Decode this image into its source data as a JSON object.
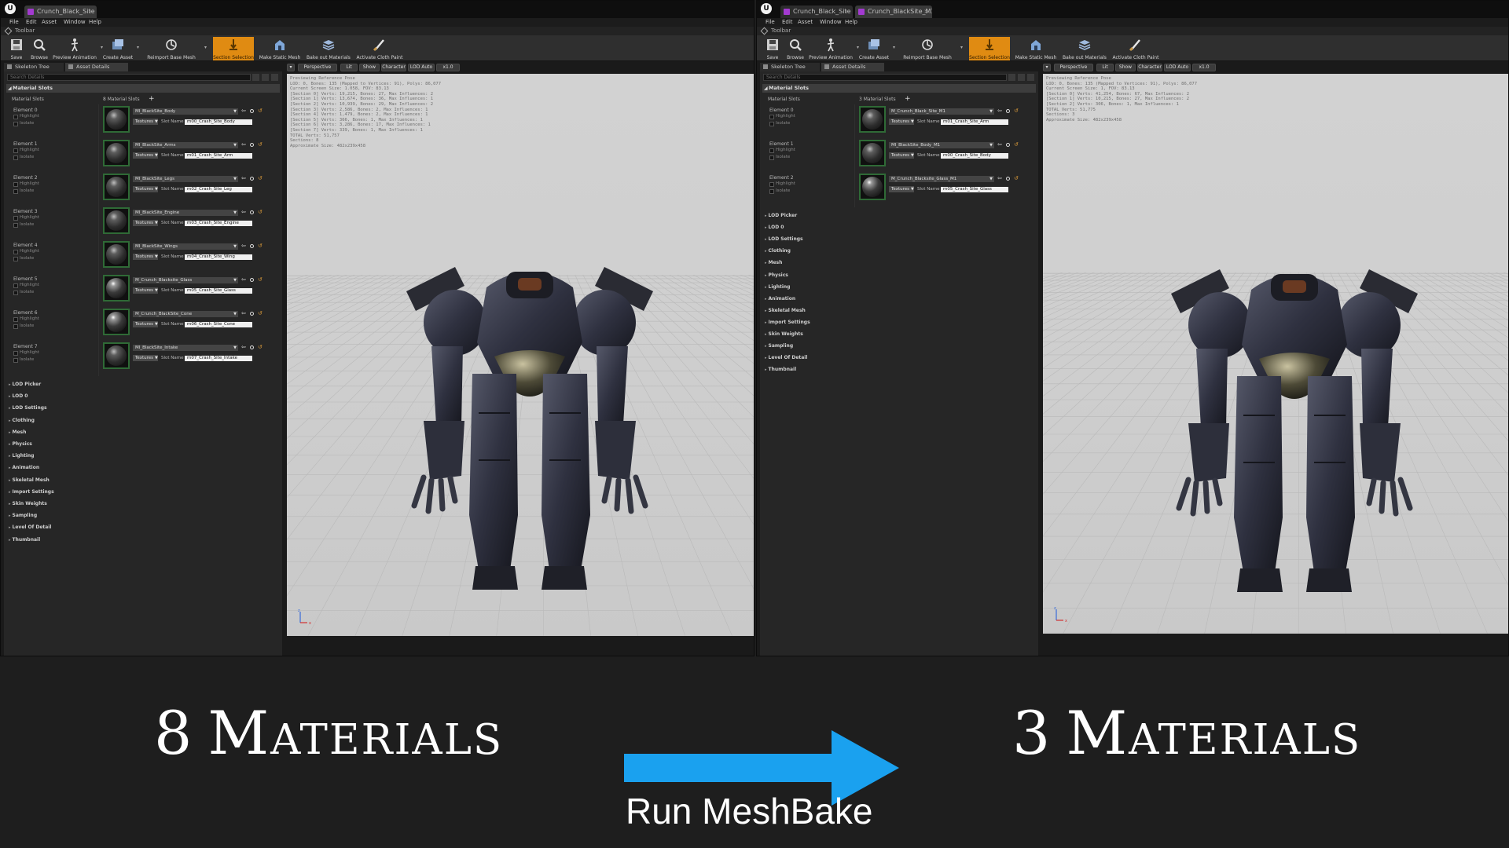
{
  "colors": {
    "accent_orange": "#e08b12",
    "arrow_blue": "#1aa1ef",
    "thumb_border": "#2f6a36",
    "viewport_bg": "#cfcfcf"
  },
  "menu": [
    "File",
    "Edit",
    "Asset",
    "Window",
    "Help"
  ],
  "toolbar_title": "Toolbar",
  "toolbar_buttons": [
    {
      "label": "Save",
      "icon": "save-icon"
    },
    {
      "label": "Browse",
      "icon": "browse-icon"
    },
    {
      "label": "Preview Animation",
      "icon": "preview-animation-icon"
    },
    {
      "label": "Create Asset",
      "icon": "create-asset-icon"
    },
    {
      "label": "Reimport Base Mesh",
      "icon": "reimport-icon"
    },
    {
      "label": "Section Selection",
      "icon": "section-selection-icon"
    },
    {
      "label": "Make Static Mesh",
      "icon": "make-static-mesh-icon"
    },
    {
      "label": "Bake out Materials",
      "icon": "bake-materials-icon"
    },
    {
      "label": "Activate Cloth Paint",
      "icon": "cloth-paint-icon"
    }
  ],
  "panel_tabs": [
    "Skeleton Tree",
    "Asset Details"
  ],
  "search_placeholder": "Search Details",
  "material_slots_header": "Material Slots",
  "material_slots_col": "Material Slots",
  "highlight_label": "Highlight",
  "isolate_label": "Isolate",
  "textures_label": "Textures",
  "slot_name_label": "Slot Name",
  "collapsed_sections": [
    "LOD Picker",
    "LOD 0",
    "LOD Settings",
    "Clothing",
    "Mesh",
    "Physics",
    "Lighting",
    "Animation",
    "Skeletal Mesh",
    "Import Settings",
    "Skin Weights",
    "Sampling",
    "Level Of Detail",
    "Thumbnail"
  ],
  "viewport_buttons": [
    "Perspective",
    "Lit",
    "Show",
    "Character",
    "LOD Auto",
    "x1.0"
  ],
  "left": {
    "tabs": [
      "Crunch_Black_Site"
    ],
    "slot_count": "8 Material Slots",
    "elements": [
      {
        "label": "Element 0",
        "material": "MI_BlackSite_Body",
        "slot": "m00_Crash_Site_Body"
      },
      {
        "label": "Element 1",
        "material": "MI_BlackSite_Arms",
        "slot": "m01_Crash_Site_Arm"
      },
      {
        "label": "Element 2",
        "material": "MI_BlackSite_Legs",
        "slot": "m02_Crash_Site_Leg"
      },
      {
        "label": "Element 3",
        "material": "MI_BlackSite_Engine",
        "slot": "m03_Crash_Site_Engine"
      },
      {
        "label": "Element 4",
        "material": "MI_BlackSite_Wings",
        "slot": "m04_Crash_Site_Wing"
      },
      {
        "label": "Element 5",
        "material": "M_Crunch_Blacksite_Glass",
        "slot": "m05_Crash_Site_Glass"
      },
      {
        "label": "Element 6",
        "material": "M_Crunch_BlackSite_Cone",
        "slot": "m06_Crash_Site_Cone"
      },
      {
        "label": "Element 7",
        "material": "MI_BlackSite_Intake",
        "slot": "m07_Crash_Site_Intake"
      }
    ],
    "stats": [
      "Previewing Reference Pose",
      "LOD: 0, Bones: 135 (Mapped to Vertices: 91), Polys: 86,077",
      "Current Screen Size: 1.058, FOV: 83.13",
      "[Section 0] Verts: 19,215, Bones: 27, Max Influences: 2",
      "[Section 1] Verts: 13,674, Bones: 36, Max Influences: 1",
      "[Section 2] Verts: 10,939, Bones: 29, Max Influences: 2",
      "[Section 3] Verts: 2,586, Bones: 2, Max Influences: 1",
      "[Section 4] Verts: 1,479, Bones: 2, Max Influences: 1",
      "[Section 5] Verts: 366, Bones: 1, Max Influences: 1",
      "[Section 6] Verts: 3,286, Bones: 17, Max Influences: 1",
      "[Section 7] Verts: 339, Bones: 1, Max Influences: 1",
      "TOTAL Verts: 51,757",
      "Sections: 8",
      "Approximate Size: 482x239x458"
    ]
  },
  "right": {
    "tabs": [
      "Crunch_Black_Site",
      "Crunch_BlackSite_M1"
    ],
    "slot_count": "3 Material Slots",
    "elements": [
      {
        "label": "Element 0",
        "material": "M_Crunch_Black_Site_M1",
        "slot": "m01_Crash_Site_Arm"
      },
      {
        "label": "Element 1",
        "material": "MI_BlackSite_Body_M1",
        "slot": "m00_Crash_Site_Body"
      },
      {
        "label": "Element 2",
        "material": "M_Crunch_Blacksite_Glass_M1",
        "slot": "m05_Crash_Site_Glass"
      }
    ],
    "stats": [
      "Previewing Reference Pose",
      "LOD: 0, Bones: 135 (Mapped to Vertices: 91), Polys: 86,077",
      "Current Screen Size: 1, FOV: 83.13",
      "[Section 0] Verts: 41,254, Bones: 67, Max Influences: 2",
      "[Section 1] Verts: 10,215, Bones: 27, Max Influences: 2",
      "[Section 2] Verts: 306, Bones: 1, Max Influences: 1",
      "TOTAL Verts: 51,775",
      "Sections: 3",
      "Approximate Size: 482x239x458"
    ]
  },
  "caption": {
    "left_number": "8",
    "left_word": "Materials",
    "right_number": "3",
    "right_word": "Materials",
    "arrow_label": "Run MeshBake"
  }
}
